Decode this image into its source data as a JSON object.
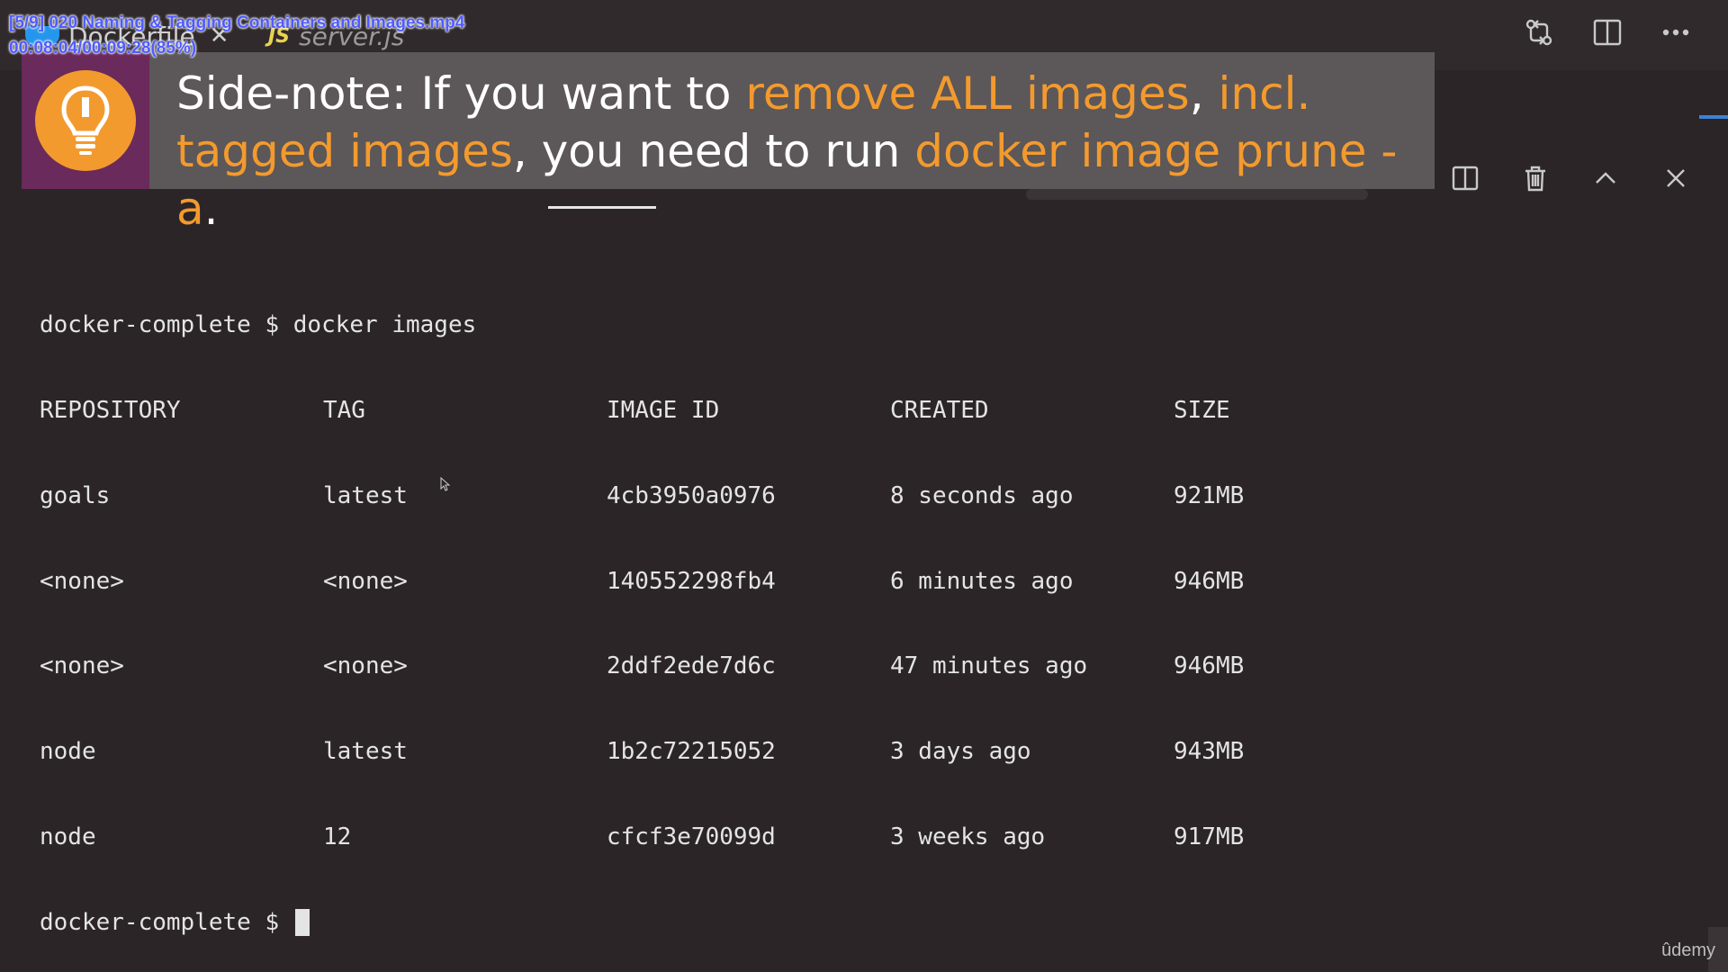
{
  "video": {
    "title": "[5/9] 020 Naming & Tagging Containers and Images.mp4",
    "time": "00:08:04/00:09:28(85%)"
  },
  "editor": {
    "tabs": [
      {
        "label": "Dockerfile",
        "icon": "docker-icon"
      },
      {
        "label": "server.js",
        "icon": "js-icon",
        "badge": "JS"
      }
    ],
    "actions": [
      "source-control-icon",
      "split-editor-icon",
      "more-icon"
    ]
  },
  "sidenote": {
    "icon": "lightbulb-icon",
    "parts": [
      {
        "text": "Side-note: If you want to ",
        "hl": false
      },
      {
        "text": "remove ALL images",
        "hl": true
      },
      {
        "text": ", ",
        "hl": false
      },
      {
        "text": "incl. tagged images",
        "hl": true
      },
      {
        "text": ", you need to run ",
        "hl": false
      },
      {
        "text": "docker image prune -a",
        "hl": true
      },
      {
        "text": ".",
        "hl": false
      }
    ],
    "accent_color": "#f39a2e",
    "icon_bg_color": "#6a2a5b"
  },
  "panel": {
    "actions": [
      "split-terminal-icon",
      "trash-icon",
      "chevron-up-icon",
      "close-icon"
    ]
  },
  "terminal": {
    "prompt": "docker-complete $ ",
    "command": "docker images",
    "headers": [
      "REPOSITORY",
      "TAG",
      "IMAGE ID",
      "CREATED",
      "SIZE"
    ],
    "rows": [
      [
        "goals",
        "latest",
        "4cb3950a0976",
        "8 seconds ago",
        "921MB"
      ],
      [
        "<none>",
        "<none>",
        "140552298fb4",
        "6 minutes ago",
        "946MB"
      ],
      [
        "<none>",
        "<none>",
        "2ddf2ede7d6c",
        "47 minutes ago",
        "946MB"
      ],
      [
        "node",
        "latest",
        "1b2c72215052",
        "3 days ago",
        "943MB"
      ],
      [
        "node",
        "12",
        "cfcf3e70099d",
        "3 weeks ago",
        "917MB"
      ]
    ],
    "final_prompt": "docker-complete $ "
  },
  "watermark": "ûdemy"
}
